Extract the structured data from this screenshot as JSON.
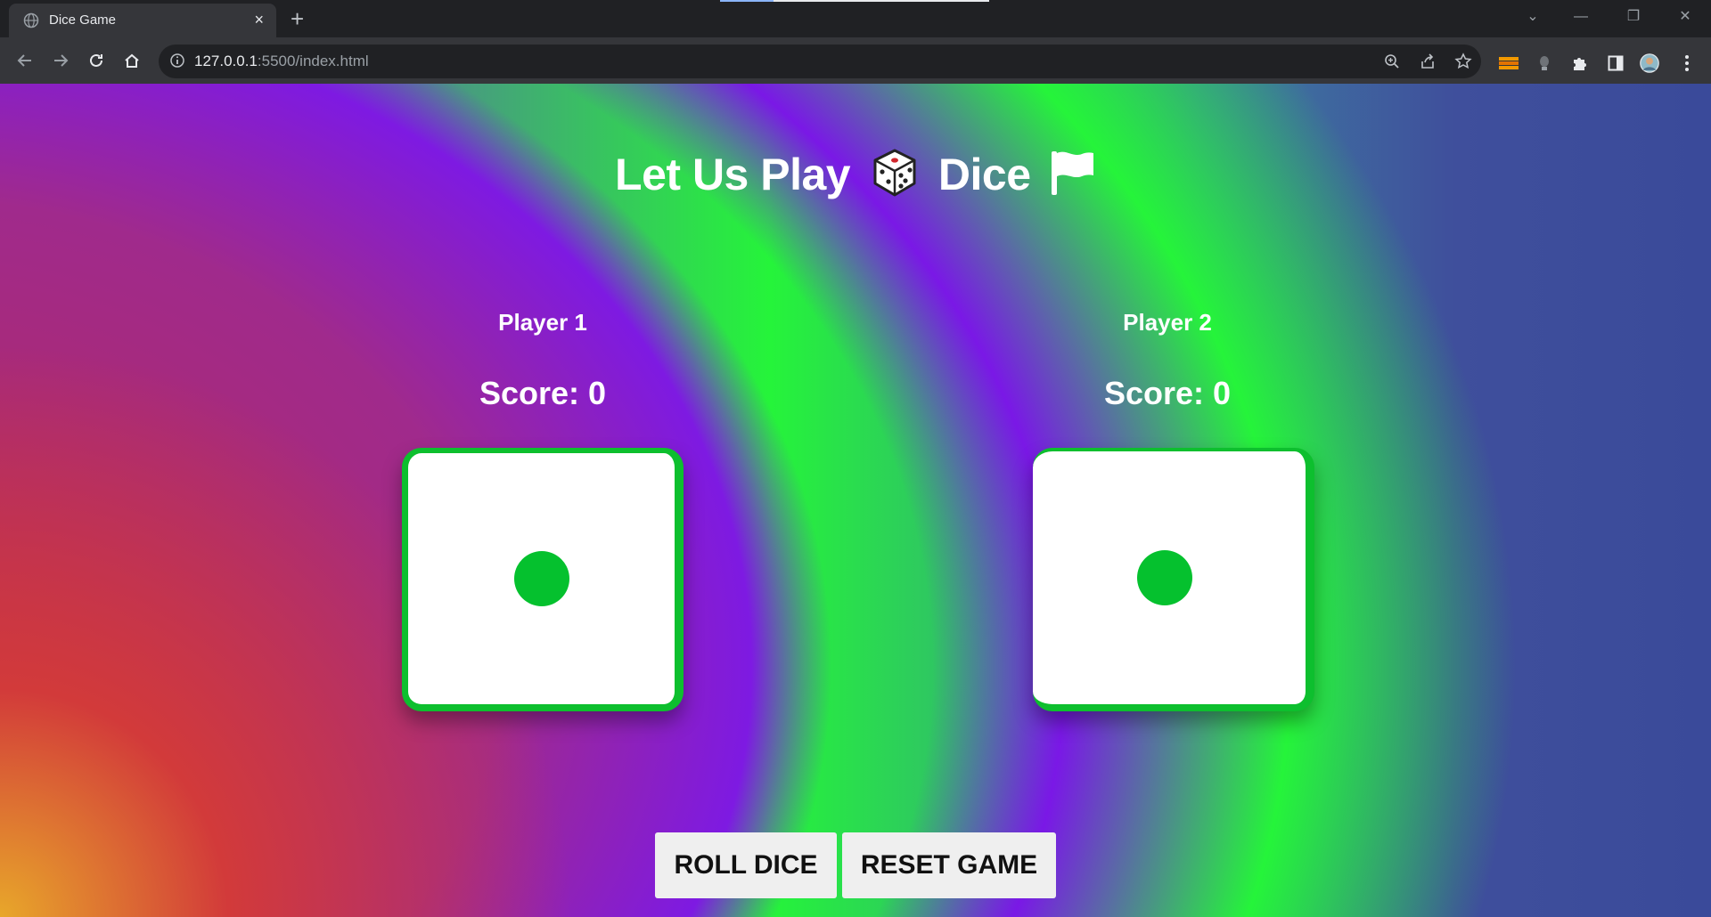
{
  "browser": {
    "tab_title": "Dice Game",
    "tab_close": "×",
    "new_tab": "+",
    "url_host": "127.0.0.1",
    "url_rest": ":5500/index.html",
    "window_controls": {
      "minimize": "—",
      "restore": "❐",
      "close": "✕",
      "tab_search": "⌄"
    }
  },
  "game": {
    "title_before": "Let Us Play",
    "title_after": "Dice",
    "title_icons": [
      "die-emoji",
      "flag-emoji"
    ],
    "players": [
      {
        "label": "Player 1",
        "score_text": "Score: 0",
        "dice_value": 1
      },
      {
        "label": "Player 2",
        "score_text": "Score: 0",
        "dice_value": 1
      }
    ],
    "buttons": {
      "roll": "ROLL DICE",
      "reset": "RESET GAME"
    },
    "colors": {
      "dice_accent": "#0dbf2e",
      "pip": "#05c12e",
      "button_bg": "#efefef"
    }
  }
}
